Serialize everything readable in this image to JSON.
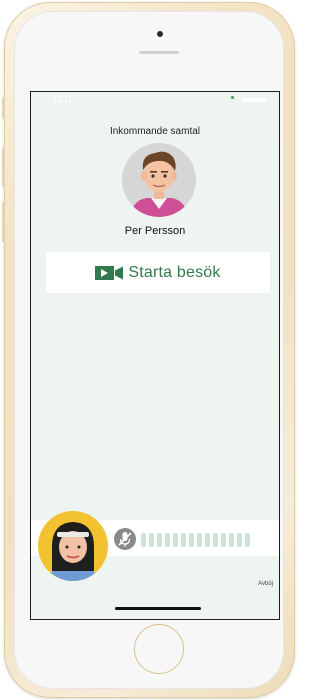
{
  "status_bar": {
    "time": "12:11"
  },
  "call": {
    "incoming_label": "Inkommande samtal",
    "caller_name": "Per Persson",
    "start_button_label": "Starta besök",
    "decline_label": "Avböj",
    "audio_level_bars": 14
  },
  "colors": {
    "accent_green": "#2f7a4e",
    "screen_background": "#eef5f0",
    "audio_bar": "#cfe2d6",
    "phone_gold": "#f3e3c4"
  },
  "icons": {
    "start_video": "video-camera-icon",
    "mic": "microphone-muted-icon"
  }
}
